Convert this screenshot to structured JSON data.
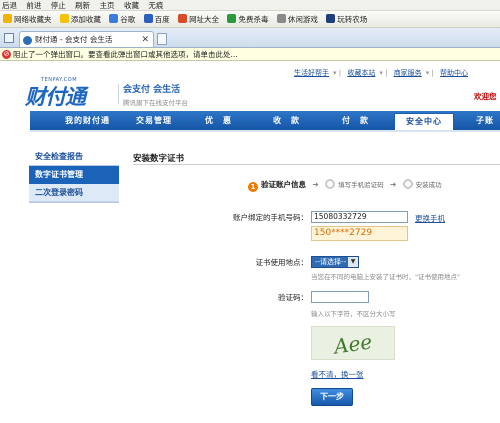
{
  "menubar": {
    "items": [
      "后退",
      "前进",
      "停止",
      "刷新",
      "主页",
      "收藏",
      "无痕"
    ]
  },
  "favbar": {
    "items": [
      {
        "label": "网络收藏夹",
        "icon": "star-icon"
      },
      {
        "label": "添加收藏",
        "icon": "star-add-icon"
      },
      {
        "label": "谷歌",
        "icon": "google-icon"
      },
      {
        "label": "百度",
        "icon": "baidu-icon"
      },
      {
        "label": "网址大全",
        "icon": "globe-icon"
      },
      {
        "label": "免费杀毒",
        "icon": "shield-icon"
      },
      {
        "label": "休闲游戏",
        "icon": "game-icon"
      },
      {
        "label": "玩转农场",
        "icon": "farm-icon"
      }
    ]
  },
  "tab": {
    "title": "财付通 - 会支付 会生活",
    "close": "✕"
  },
  "popup": {
    "text": "阻止了一个弹出窗口。要查看此弹出窗口或其他选项，请单击此处..."
  },
  "header": {
    "links": [
      "生活好帮手",
      "收藏本站",
      "商家服务",
      "帮助中心"
    ],
    "welcome": "欢迎您",
    "logo_small": "TENPAY.COM",
    "logo_text": "财付通",
    "slogan_main": "会支付 会生活",
    "slogan_sub": "腾讯旗下在线支付平台"
  },
  "nav": {
    "items": [
      "我的财付通",
      "交易管理",
      "优　惠",
      "收　款",
      "付　款",
      "安全中心",
      "子账户"
    ],
    "active": "安全中心"
  },
  "sidebar": {
    "items": [
      "安全检查报告",
      "数字证书管理",
      "二次登录密码"
    ]
  },
  "main": {
    "title": "安装数字证书",
    "steps": [
      {
        "num": "1",
        "label": "验证账户信息"
      },
      {
        "label": "填写手机验证码"
      },
      {
        "label": "安装成功"
      }
    ],
    "arrow": "➔",
    "form": {
      "phone_label": "账户绑定的手机号码：",
      "phone_value": "15080332729",
      "change_phone": "更换手机",
      "phone_masked": "150****2729",
      "location_label": "证书使用地点：",
      "location_selected": "--请选择--",
      "location_hint": "当您在不同的电脑上安装了证书时，\"证书使用地点\"",
      "code_label": "验证码：",
      "code_hint": "输入以下字符，不区分大小写",
      "captcha_text": "Aee",
      "refresh": "看不清，换一张",
      "next_button": "下一步"
    }
  }
}
